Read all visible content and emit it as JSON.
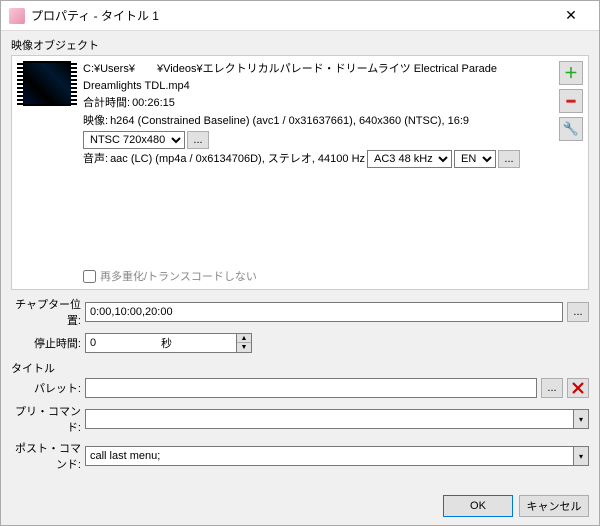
{
  "window": {
    "title": "プロパティ - タイトル 1"
  },
  "groups": {
    "video": "映像オブジェクト",
    "title": "タイトル"
  },
  "video": {
    "path": "C:¥Users¥　　¥Videos¥エレクトリカルパレード・ドリームライツ Electrical Parade Dreamlights TDL.mp4",
    "duration_label": "合計時間:",
    "duration": "00:26:15",
    "video_label": "映像:",
    "video_codec": "h264 (Constrained Baseline) (avc1 / 0x31637661), 640x360 (NTSC), 16:9",
    "video_format": "NTSC 720x480",
    "audio_label": "音声:",
    "audio_codec": "aac (LC) (mp4a / 0x6134706D), ステレオ, 44100 Hz",
    "audio_format": "AC3 48 kHz",
    "audio_lang": "EN",
    "ellipsis": "...",
    "remux_label": "再多重化/トランスコードしない"
  },
  "fields": {
    "chapter_label": "チャプター位置:",
    "chapter_value": "0:00,10:00,20:00",
    "pause_label": "停止時間:",
    "pause_value": "0",
    "pause_unit": "秒",
    "palette_label": "パレット:",
    "palette_value": "",
    "pre_label": "プリ・コマンド:",
    "pre_value": "",
    "post_label": "ポスト・コマンド:",
    "post_value": "call last menu;",
    "ellipsis": "..."
  },
  "buttons": {
    "ok": "OK",
    "cancel": "キャンセル"
  }
}
